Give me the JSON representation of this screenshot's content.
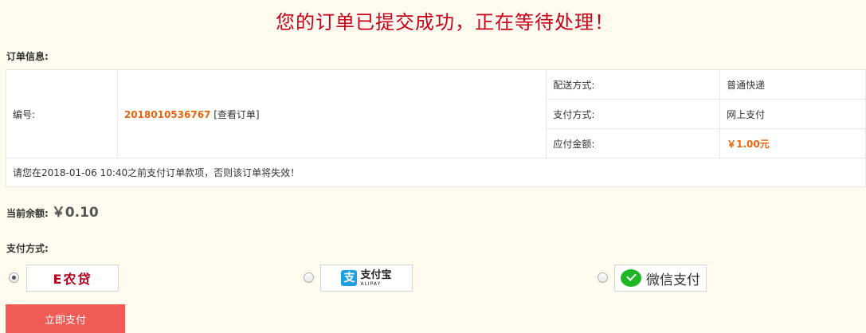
{
  "header": {
    "title": "您的订单已提交成功，正在等待处理！"
  },
  "order_info": {
    "label": "订单信息:",
    "number_label": "编号:",
    "number_value": "2018010536767",
    "view_link": "[查看订单]",
    "delivery_label": "配送方式:",
    "delivery_value": "普通快递",
    "payment_label": "支付方式:",
    "payment_value": "网上支付",
    "amount_label": "应付金额:",
    "amount_value": "￥1.00元",
    "notice": "请您在2018-01-06 10:40之前支付订单款项，否则该订单将失效！"
  },
  "balance": {
    "label": "当前余额:",
    "value": "￥0.10"
  },
  "payment_methods": {
    "label": "支付方式:",
    "options": [
      {
        "name": "E农贷",
        "selected": true
      },
      {
        "name": "支付宝",
        "sub": "ALIPAY",
        "selected": false
      },
      {
        "name": "微信支付",
        "selected": false
      }
    ]
  },
  "pay_button": {
    "label": "立即支付"
  },
  "colors": {
    "title": "#c8001d",
    "highlight": "#e8650e",
    "button": "#f05b55",
    "background": "#fffbee"
  }
}
